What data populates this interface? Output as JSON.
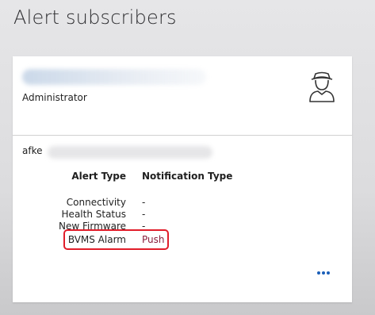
{
  "page": {
    "title": "Alert subscribers"
  },
  "subscriber": {
    "role": "Administrator",
    "email_prefix": "afke",
    "icon": "user-hat-icon"
  },
  "alerts": {
    "headers": {
      "alert_type": "Alert Type",
      "notification_type": "Notification Type"
    },
    "rows": [
      {
        "type": "Connectivity",
        "notification": "-"
      },
      {
        "type": "Health Status",
        "notification": "-"
      },
      {
        "type": "New Firmware",
        "notification": "-"
      },
      {
        "type": "BVMS Alarm",
        "notification": "Push"
      }
    ]
  },
  "colors": {
    "push_text": "#8a1c3a",
    "highlight": "#e11d2a",
    "more_icon": "#1b5fb8"
  },
  "actions": {
    "more_icon": "ellipsis-icon"
  }
}
